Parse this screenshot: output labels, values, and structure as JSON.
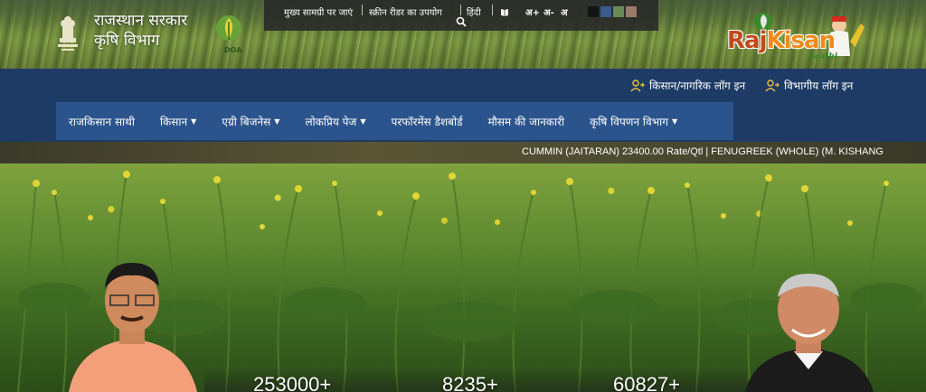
{
  "header": {
    "gov_title_line1": "राजस्थान सरकार",
    "gov_title_line2": "कृषि विभाग",
    "doa_label": "DOA",
    "brand_raj": "Raj",
    "brand_kisan": "Kisan",
    "brand_saathi": "Saathi"
  },
  "topbar": {
    "skip_to_content": "मुख्य सामग्री पर जाएं",
    "screen_reader": "स्क्रीन रीडर का उपयोग",
    "language": "हिंदी",
    "font_increase": "अ+",
    "font_decrease": "अ-",
    "font_normal": "अ",
    "theme_colors": [
      "#141414",
      "#3b5b8c",
      "#6a8a5a",
      "#9a7b6a"
    ],
    "icons": [
      "search-icon",
      "book-icon"
    ]
  },
  "login": {
    "farmer_login": "किसान/नागरिक लॉग इन",
    "department_login": "विभागीय लॉग इन"
  },
  "menu": {
    "items": [
      {
        "label": "राजकिसान साथी",
        "dropdown": false
      },
      {
        "label": "किसान",
        "dropdown": true
      },
      {
        "label": "एग्री बिजनेस",
        "dropdown": true
      },
      {
        "label": "लोकप्रिय पेज",
        "dropdown": true
      },
      {
        "label": "परफॉरमेंस डैशबोर्ड",
        "dropdown": false
      },
      {
        "label": "मौसम की जानकारी",
        "dropdown": false
      },
      {
        "label": "कृषि विपणन विभाग",
        "dropdown": true
      }
    ]
  },
  "ticker": {
    "text": "CUMMIN (JAITARAN) 23400.00 Rate/Qtl | FENUGREEK (WHOLE) (M. KISHANG"
  },
  "hero": {
    "stats": [
      "253000+",
      "8235+",
      "60827+"
    ]
  },
  "colors": {
    "blue_band": "#1e3b66",
    "menu_bg": "#2b548c",
    "topbar_bg": "#282828"
  }
}
